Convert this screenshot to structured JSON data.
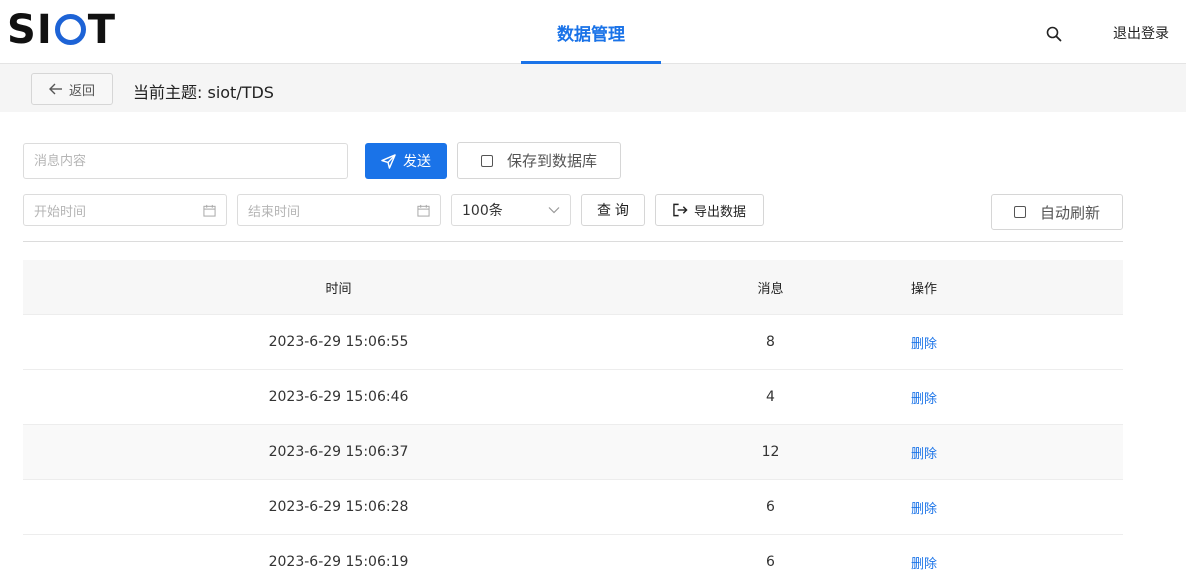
{
  "header": {
    "logo": {
      "left": "S",
      "mid": "I",
      "right": "T"
    },
    "nav_tab": "数据管理",
    "logout": "退出登录",
    "accent": "#1a73e8"
  },
  "topic_bar": {
    "back_label": "返回",
    "topic": "当前主题: siot/TDS"
  },
  "form": {
    "message_placeholder": "消息内容",
    "send_label": "发送",
    "save_db_label": "保存到数据库",
    "start_time_placeholder": "开始时间",
    "end_time_placeholder": "结束时间",
    "count_value": "100条",
    "query_label": "查 询",
    "export_label": "导出数据",
    "auto_refresh_label": "自动刷新"
  },
  "table": {
    "headers": {
      "time": "时间",
      "message": "消息",
      "action": "操作"
    },
    "rows": [
      {
        "time": "2023-6-29 15:06:55",
        "message": "8",
        "action": "删除"
      },
      {
        "time": "2023-6-29 15:06:46",
        "message": "4",
        "action": "删除"
      },
      {
        "time": "2023-6-29 15:06:37",
        "message": "12",
        "action": "删除"
      },
      {
        "time": "2023-6-29 15:06:28",
        "message": "6",
        "action": "删除"
      },
      {
        "time": "2023-6-29 15:06:19",
        "message": "6",
        "action": "删除"
      }
    ]
  }
}
